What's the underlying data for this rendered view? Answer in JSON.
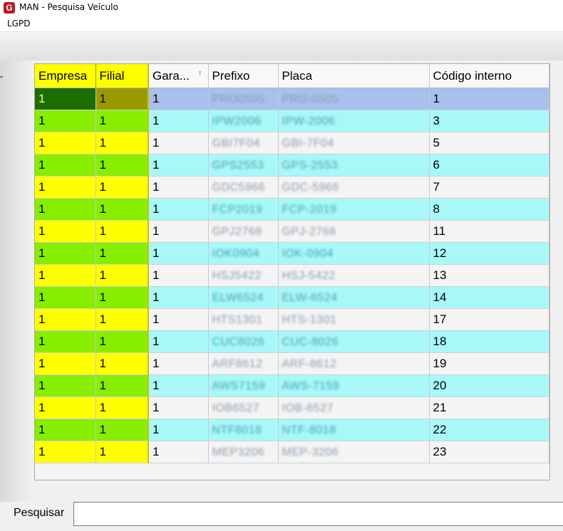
{
  "window": {
    "app_icon": "G",
    "title": "MAN - Pesquisa Veículo"
  },
  "menu": [
    {
      "label": "LGPD"
    }
  ],
  "grid": {
    "columns": [
      "Empresa",
      "Filial",
      "Gara...",
      "Prefixo",
      "Placa",
      "Código interno"
    ],
    "sort_icon": "sort-descending-icon",
    "sort_glyph": "↑",
    "rows": [
      {
        "empresa": "1",
        "filial": "1",
        "garagem": "1",
        "prefixo": "PRO0505",
        "placa": "PRO-0505",
        "codigo": "1"
      },
      {
        "empresa": "1",
        "filial": "1",
        "garagem": "1",
        "prefixo": "IPW2006",
        "placa": "IPW-2006",
        "codigo": "3"
      },
      {
        "empresa": "1",
        "filial": "1",
        "garagem": "1",
        "prefixo": "GBI7F04",
        "placa": "GBI-7F04",
        "codigo": "5"
      },
      {
        "empresa": "1",
        "filial": "1",
        "garagem": "1",
        "prefixo": "GPS2553",
        "placa": "GPS-2553",
        "codigo": "6"
      },
      {
        "empresa": "1",
        "filial": "1",
        "garagem": "1",
        "prefixo": "GDC5966",
        "placa": "GDC-5966",
        "codigo": "7"
      },
      {
        "empresa": "1",
        "filial": "1",
        "garagem": "1",
        "prefixo": "FCP2019",
        "placa": "FCP-2019",
        "codigo": "8"
      },
      {
        "empresa": "1",
        "filial": "1",
        "garagem": "1",
        "prefixo": "GPJ2768",
        "placa": "GPJ-2768",
        "codigo": "11"
      },
      {
        "empresa": "1",
        "filial": "1",
        "garagem": "1",
        "prefixo": "IOK0904",
        "placa": "IOK-0904",
        "codigo": "12"
      },
      {
        "empresa": "1",
        "filial": "1",
        "garagem": "1",
        "prefixo": "HSJ5422",
        "placa": "HSJ-5422",
        "codigo": "13"
      },
      {
        "empresa": "1",
        "filial": "1",
        "garagem": "1",
        "prefixo": "ELW6524",
        "placa": "ELW-6524",
        "codigo": "14"
      },
      {
        "empresa": "1",
        "filial": "1",
        "garagem": "1",
        "prefixo": "HTS1301",
        "placa": "HTS-1301",
        "codigo": "17"
      },
      {
        "empresa": "1",
        "filial": "1",
        "garagem": "1",
        "prefixo": "CUC8026",
        "placa": "CUC-8026",
        "codigo": "18"
      },
      {
        "empresa": "1",
        "filial": "1",
        "garagem": "1",
        "prefixo": "ARF8612",
        "placa": "ARF-8612",
        "codigo": "19"
      },
      {
        "empresa": "1",
        "filial": "1",
        "garagem": "1",
        "prefixo": "AWS7159",
        "placa": "AWS-7159",
        "codigo": "20"
      },
      {
        "empresa": "1",
        "filial": "1",
        "garagem": "1",
        "prefixo": "IOB6527",
        "placa": "IOB-6527",
        "codigo": "21"
      },
      {
        "empresa": "1",
        "filial": "1",
        "garagem": "1",
        "prefixo": "NTF8018",
        "placa": "NTF-8018",
        "codigo": "22"
      },
      {
        "empresa": "1",
        "filial": "1",
        "garagem": "1",
        "prefixo": "MEP3206",
        "placa": "MEP-3206",
        "codigo": "23"
      }
    ]
  },
  "search": {
    "label": "Pesquisar",
    "value": ""
  }
}
